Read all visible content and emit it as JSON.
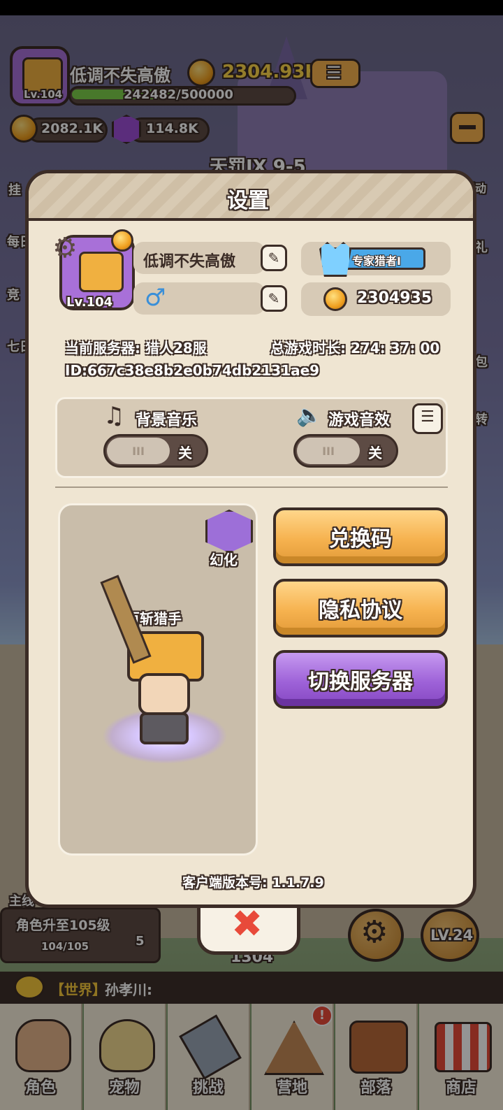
{
  "hud": {
    "player_name": "低调不失高傲",
    "avatar_level": "Lv.104",
    "exp_text": "242482/500000",
    "exp_fraction": 0.485,
    "gold_amount": "2304.93K",
    "coin_amount": "2082.1K",
    "gem_amount": "114.8K",
    "stage_text": "天罚IX 9-5"
  },
  "side_left": [
    "挂",
    "每日",
    "竞",
    "七日"
  ],
  "side_right": [
    "活动",
    "礼",
    "包",
    "转"
  ],
  "settings": {
    "title": "设置",
    "avatar_level": "Lv.104",
    "nickname": "低调不失高傲",
    "gender_symbol": "♂",
    "rank_badge": "专家猎者I",
    "score": "2304935",
    "server_text": "当前服务器: 猎人28服",
    "playtime_text": "总游戏时长: 274: 37: 00",
    "id_text": "ID:667c38e8b2e0b74db2131ae9",
    "music_label": "背景音乐",
    "music_toggle": "关",
    "sfx_label": "游戏音效",
    "sfx_toggle": "关",
    "transform_label": "幻化",
    "character_name": "百斩猎手",
    "redeem_button": "兑换码",
    "privacy_button": "隐私协议",
    "switch_server_button": "切换服务器",
    "version_text": "客户端版本号: 1.1.7.9"
  },
  "bottom_area": {
    "mission_tag": "主线",
    "mission_text": "角色升至105级",
    "mission_progress": "104/105",
    "item_count": "5",
    "stage_number": "1304",
    "level_badge": "LV.24",
    "chat_channel": "【世界】",
    "chat_user": "孙孝川:"
  },
  "nav": [
    "角色",
    "宠物",
    "挑战",
    "营地",
    "部落",
    "商店"
  ],
  "colors": {
    "outline": "#3b2c26",
    "modal_bg": "#efe5d2",
    "orange_button": "#f6b24f",
    "purple_button": "#9e62d8",
    "rank_badge": "#4aa8e8"
  }
}
